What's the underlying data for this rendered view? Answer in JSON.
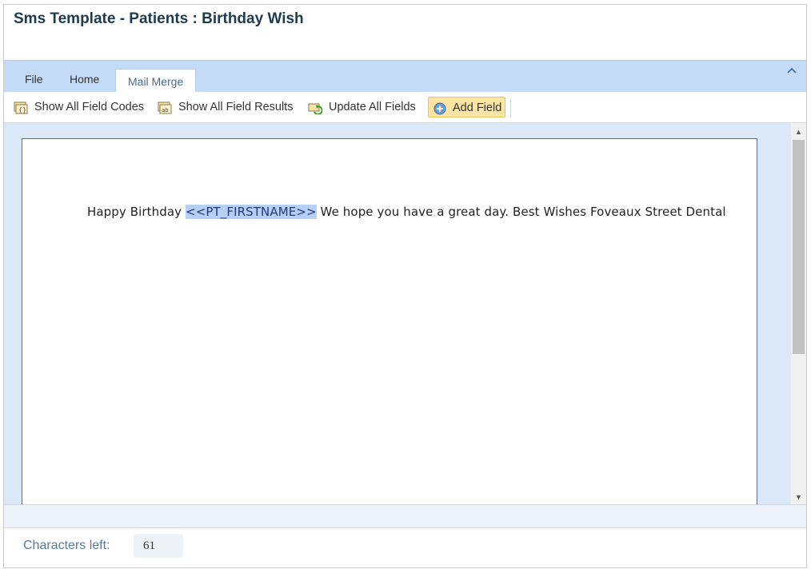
{
  "window": {
    "title": "Sms Template - Patients : Birthday Wish"
  },
  "ribbon": {
    "tabs": [
      {
        "label": "File"
      },
      {
        "label": "Home"
      },
      {
        "label": "Mail Merge",
        "active": true
      }
    ],
    "collapse_icon": "chevron-up-icon"
  },
  "toolbar": {
    "buttons": [
      {
        "label": "Show All Field Codes",
        "icon": "field-codes-icon"
      },
      {
        "label": "Show All Field Results",
        "icon": "field-results-icon"
      },
      {
        "label": "Update All Fields",
        "icon": "update-fields-icon"
      },
      {
        "label": "Add Field",
        "icon": "add-circle-icon",
        "highlighted": true
      }
    ]
  },
  "editor": {
    "text_before": "Happy Birthday ",
    "merge_field": "<<PT_FIRSTNAME>>",
    "text_after": " We hope you have a great day. Best Wishes Foveaux Street Dental"
  },
  "footer": {
    "characters_left_label": "Characters left:",
    "characters_left_value": "61"
  },
  "colors": {
    "ribbon_bg": "#c4dbf7",
    "highlight_button": "#fce5a4",
    "field_highlight": "#b5d0f5",
    "title_color": "#1f3a4d"
  }
}
